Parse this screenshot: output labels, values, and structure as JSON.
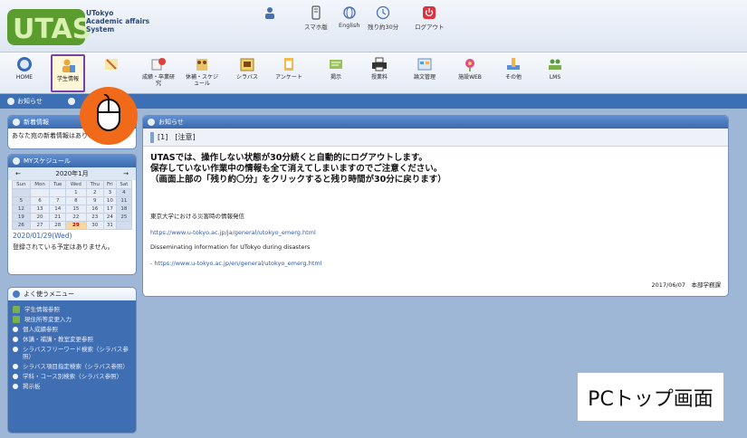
{
  "app": {
    "logo_text": "UTAS",
    "logo_lines": [
      "UTokyo",
      "Academic affairs",
      "System"
    ]
  },
  "header_links": [
    {
      "label": "",
      "icon": "person-icon"
    },
    {
      "label": "スマホ版",
      "icon": "smartphone-icon"
    },
    {
      "label": "English",
      "icon": "globe-icon"
    },
    {
      "label": "残り約30分",
      "icon": "clock-icon"
    },
    {
      "label": "ログアウト",
      "icon": "power-icon"
    }
  ],
  "toolbar": [
    {
      "label": "HOME",
      "icon": "home-icon"
    },
    {
      "label": "学生情報",
      "icon": "student-info-icon"
    },
    {
      "label": "",
      "icon": "pencil-icon"
    },
    {
      "label": "成績・卒業研究",
      "icon": "grades-icon"
    },
    {
      "label": "休補・スケジュール",
      "icon": "schedule-icon"
    },
    {
      "label": "シラバス",
      "icon": "syllabus-icon"
    },
    {
      "label": "アンケート",
      "icon": "survey-icon"
    },
    {
      "label": "掲示",
      "icon": "bulletin-icon"
    },
    {
      "label": "授業料",
      "icon": "printer-icon"
    },
    {
      "label": "論文管理",
      "icon": "thesis-icon"
    },
    {
      "label": "施設WEB",
      "icon": "facility-icon"
    },
    {
      "label": "その他",
      "icon": "other-icon"
    },
    {
      "label": "LMS",
      "icon": "lms-icon"
    }
  ],
  "tabs": [
    {
      "label": "お知らせ"
    }
  ],
  "news_panel": {
    "title": "新着情報",
    "body": "あなた宛の新着情報はありません。"
  },
  "schedule_panel": {
    "title": "MYスケジュール",
    "month": "2020年1月",
    "prev": "←",
    "next": "→",
    "weekdays": [
      "Sun",
      "Mon",
      "Tue",
      "Wed",
      "Thu",
      "Fri",
      "Sat"
    ],
    "weeks": [
      [
        "",
        "",
        "",
        "1",
        "2",
        "3",
        "4"
      ],
      [
        "5",
        "6",
        "7",
        "8",
        "9",
        "10",
        "11"
      ],
      [
        "12",
        "13",
        "14",
        "15",
        "16",
        "17",
        "18"
      ],
      [
        "19",
        "20",
        "21",
        "22",
        "23",
        "24",
        "25"
      ],
      [
        "26",
        "27",
        "28",
        "29",
        "30",
        "31",
        ""
      ]
    ],
    "selected_day": "29",
    "selected_date": "2020/01/29(Wed)",
    "no_events": "登録されている予定はありません。"
  },
  "menu_panel": {
    "title": "よく使うメニュー",
    "items": [
      {
        "label": "学生情報参照",
        "type": "square"
      },
      {
        "label": "現住所等変更入力",
        "type": "square"
      },
      {
        "label": "個人成績参照",
        "type": "bullet"
      },
      {
        "label": "休講・補講・教室変更参照",
        "type": "bullet"
      },
      {
        "label": "シラバスフリーワード検索（シラバス参照）",
        "type": "bullet"
      },
      {
        "label": "シラバス項目指定検索（シラバス参照）",
        "type": "bullet"
      },
      {
        "label": "学科・コース別検索（シラバス参照）",
        "type": "bullet"
      },
      {
        "label": "掲示板",
        "type": "bullet"
      }
    ]
  },
  "notice_panel": {
    "title": "お知らせ",
    "bar": "[1]　[注意]",
    "warning_lines": [
      "UTASでは、操作しない状態が30分続くと自動的にログアウトします。",
      "保存していない作業中の情報も全て消えてしまいますのでご注意ください。",
      "（画面上部の「残り約〇分」をクリックすると残り時間が30分に戻ります）"
    ],
    "jp_heading": "東京大学における災害時の情報発信",
    "jp_link": "https://www.u-tokyo.ac.jp/ja/general/utokyo_emerg.html",
    "en_heading": "Disseminating information for UTokyo during disasters",
    "en_link": "- https://www.u-tokyo.ac.jp/en/general/utokyo_emerg.html",
    "footer": "2017/06/07　本部学務課"
  },
  "caption": "PCトップ画面",
  "colors": {
    "accent": "#3d6fb4",
    "highlight_border": "#7b3fa8",
    "cursor_circle": "#f06a1a"
  }
}
